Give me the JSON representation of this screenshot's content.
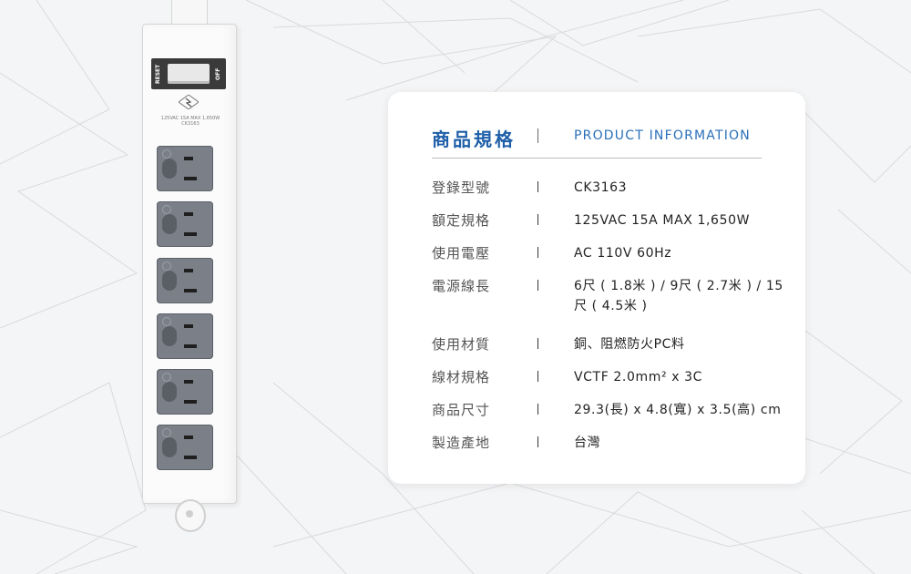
{
  "product_image": {
    "switch_reset_label": "RESET",
    "switch_off_label": "OFF",
    "spec_print_line1": "125VAC 15A MAX 1,650W",
    "spec_print_line2": "CK3163",
    "outlet_count": 6
  },
  "card": {
    "title_zh": "商品規格",
    "title_en": "PRODUCT INFORMATION",
    "accent_color": "#1e5fa8",
    "rows": [
      {
        "label": "登錄型號",
        "value": "CK3163"
      },
      {
        "label": "額定規格",
        "value": "125VAC 15A MAX 1,650W"
      },
      {
        "label": "使用電壓",
        "value": "AC 110V 60Hz"
      },
      {
        "label": "電源線長",
        "value": "6尺 ( 1.8米 ) / 9尺 ( 2.7米 ) / 15尺 ( 4.5米 )"
      },
      {
        "label": "使用材質",
        "value": "銅、阻燃防火PC料"
      },
      {
        "label": "線材規格",
        "value": "VCTF 2.0mm² x 3C"
      },
      {
        "label": "商品尺寸",
        "value": "29.3(長) x 4.8(寬) x 3.5(高) cm"
      },
      {
        "label": "製造產地",
        "value": "台灣"
      }
    ]
  }
}
